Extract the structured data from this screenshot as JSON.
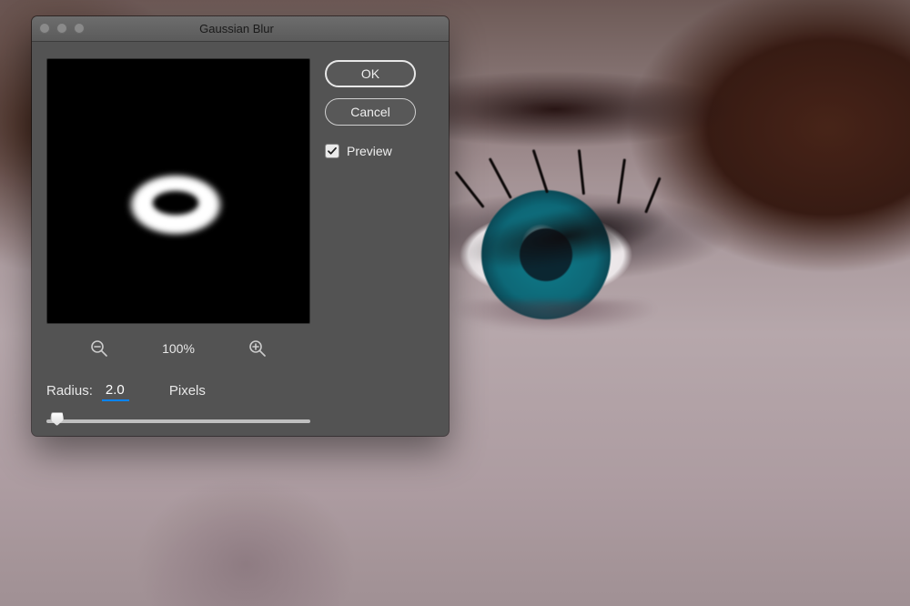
{
  "dialog": {
    "title": "Gaussian Blur",
    "buttons": {
      "ok": "OK",
      "cancel": "Cancel"
    },
    "preview": {
      "label": "Preview",
      "checked": true
    },
    "zoom": {
      "level": "100%"
    },
    "radius": {
      "label": "Radius:",
      "value": "2.0",
      "unit": "Pixels",
      "slider_percent": 4
    }
  }
}
